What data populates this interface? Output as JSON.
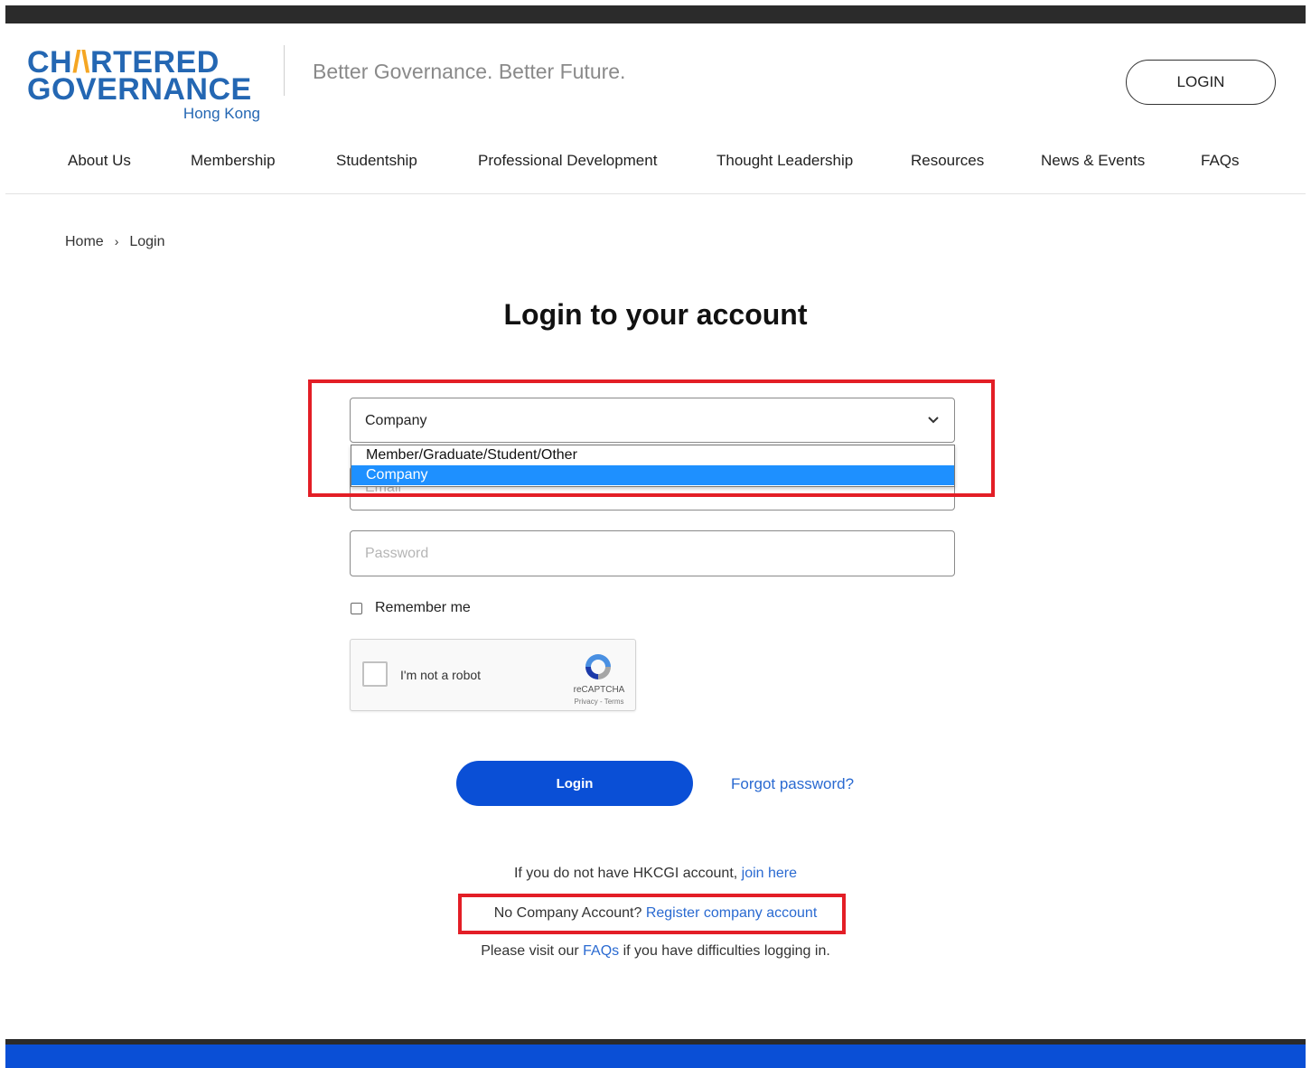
{
  "brand": {
    "logo_line1_a": "CH",
    "logo_line1_b": "RTERED",
    "logo_line2_a": "GO",
    "logo_line2_b": "ERNANCE",
    "logo_sub": "Hong Kong",
    "tagline": "Better Governance. Better Future.",
    "accent_color": "#f5a623",
    "brand_color": "#2467b3"
  },
  "header": {
    "login_label": "LOGIN"
  },
  "nav": {
    "items": [
      {
        "label": "About Us"
      },
      {
        "label": "Membership"
      },
      {
        "label": "Studentship"
      },
      {
        "label": "Professional Development"
      },
      {
        "label": "Thought Leadership"
      },
      {
        "label": "Resources"
      },
      {
        "label": "News & Events"
      },
      {
        "label": "FAQs"
      }
    ]
  },
  "breadcrumb": {
    "home": "Home",
    "separator": "›",
    "current": "Login"
  },
  "page": {
    "title": "Login to your account"
  },
  "form": {
    "account_type": {
      "selected": "Company",
      "options": [
        "Member/Graduate/Student/Other",
        "Company"
      ],
      "highlighted_option": "Company"
    },
    "email_placeholder": "Email",
    "password_placeholder": "Password",
    "remember_label": "Remember me",
    "recaptcha": {
      "label": "I'm not a robot",
      "brand": "reCAPTCHA",
      "terms": "Privacy - Terms"
    },
    "login_button": "Login",
    "forgot_link": "Forgot password?"
  },
  "links": {
    "join_prefix": "If you do not have HKCGI account, ",
    "join_link": "join here",
    "company_prefix": "No Company Account? ",
    "company_link": "Register company account",
    "faq_prefix": "Please visit our ",
    "faq_link": "FAQs",
    "faq_suffix": " if you have difficulties logging in."
  },
  "colors": {
    "primary_button": "#0a4fd6",
    "link": "#2a6ad1",
    "highlight_annotation": "#e31e26",
    "dropdown_selected": "#1e90ff"
  }
}
